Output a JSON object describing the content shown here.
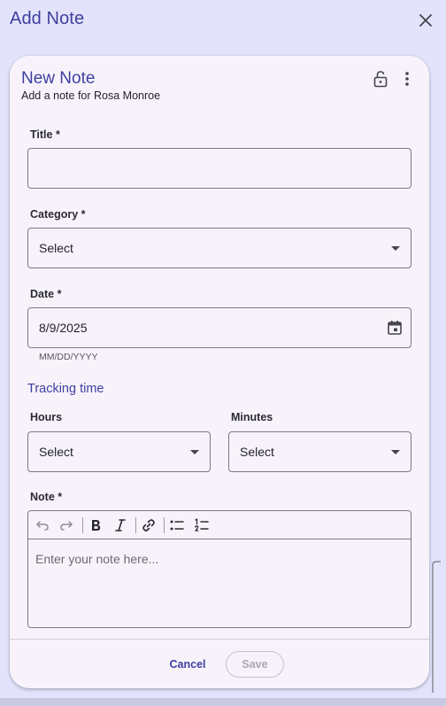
{
  "dialog": {
    "title": "Add Note"
  },
  "card": {
    "title": "New Note",
    "subtitle": "Add a note for Rosa Monroe"
  },
  "form": {
    "title_label": "Title *",
    "title_value": "",
    "category_label": "Category *",
    "category_value": "Select",
    "date_label": "Date *",
    "date_value": "8/9/2025",
    "date_helper": "MM/DD/YYYY",
    "tracking_title": "Tracking time",
    "hours_label": "Hours",
    "hours_value": "Select",
    "minutes_label": "Minutes",
    "minutes_value": "Select",
    "note_label": "Note *",
    "note_placeholder": "Enter your note here..."
  },
  "toolbar": {
    "tools": [
      "undo-icon",
      "redo-icon",
      "bold-icon",
      "italic-icon",
      "link-icon",
      "bullet-list-icon",
      "numbered-list-icon"
    ]
  },
  "footer": {
    "cancel_label": "Cancel",
    "save_label": "Save"
  },
  "colors": {
    "background": "#e3e3fb",
    "card": "#f8f3fb",
    "accent": "#3f3fa0",
    "border": "#7a7a85",
    "disabled": "#a8a6ae"
  }
}
